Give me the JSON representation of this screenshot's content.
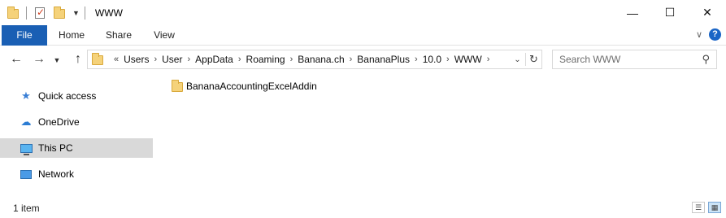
{
  "window": {
    "title": "WWW",
    "icons": [
      "folder-icon",
      "properties-icon",
      "new-folder-icon",
      "customize-dropdown-icon"
    ],
    "controls": {
      "minimize": "—",
      "maximize": "☐",
      "close": "✕"
    }
  },
  "ribbon": {
    "tabs": [
      {
        "label": "File",
        "active": true
      },
      {
        "label": "Home"
      },
      {
        "label": "Share"
      },
      {
        "label": "View"
      }
    ],
    "accent": "#1a5fb4",
    "expand_icon": "chevron-down-icon",
    "help_label": "?"
  },
  "navigation": {
    "back": "←",
    "forward": "→",
    "recent": "⌄",
    "up": "↑",
    "address": {
      "overflow": "«",
      "breadcrumbs": [
        "Users",
        "User",
        "AppData",
        "Roaming",
        "Banana.ch",
        "BananaPlus",
        "10.0",
        "WWW"
      ],
      "separator": "›",
      "dropdown": "⌄",
      "refresh": "↻"
    },
    "search": {
      "placeholder": "Search WWW",
      "icon": "search-icon"
    }
  },
  "nav_pane": {
    "items": [
      {
        "label": "Quick access",
        "icon": "star-icon"
      },
      {
        "label": "OneDrive",
        "icon": "cloud-icon"
      },
      {
        "label": "This PC",
        "icon": "computer-icon",
        "selected": true
      },
      {
        "label": "Network",
        "icon": "network-icon"
      }
    ]
  },
  "content": {
    "files": [
      {
        "name": "BananaAccountingExcelAddin",
        "type": "folder"
      }
    ]
  },
  "status": {
    "item_count": "1 item",
    "views": [
      "details-view-icon",
      "large-icons-view-icon"
    ]
  }
}
